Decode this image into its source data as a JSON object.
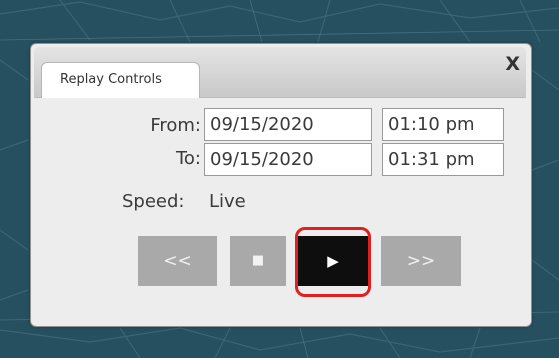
{
  "panel": {
    "tab_label": "Replay Controls",
    "close_label": "X"
  },
  "from": {
    "label": "From:",
    "date": "09/15/2020",
    "time": "01:10 pm"
  },
  "to": {
    "label": "To:",
    "date": "09/15/2020",
    "time": "01:31 pm"
  },
  "speed": {
    "label": "Speed:",
    "value": "Live"
  },
  "controls": {
    "rewind_label": "<<",
    "stop_label": "■",
    "play_label": "▶",
    "forward_label": ">>"
  },
  "colors": {
    "map_background": "#264f5f",
    "panel_background": "#ededed",
    "button_gray": "#a9a9a9",
    "play_button": "#0e0e0e",
    "highlight_red": "#e02020"
  }
}
